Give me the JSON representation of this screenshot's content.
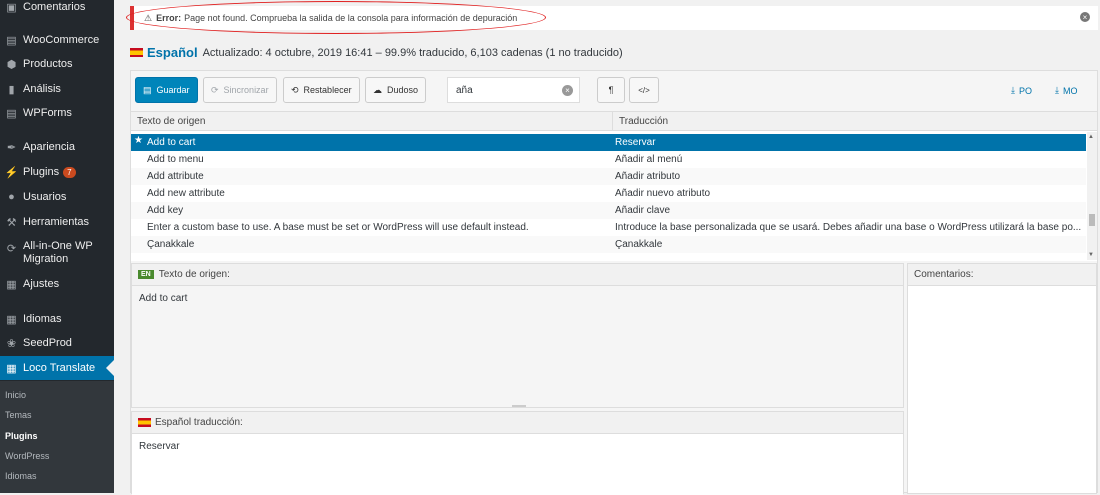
{
  "sidebar": {
    "items": [
      {
        "label": "Comentarios",
        "icon": "comment-icon"
      },
      {
        "label": "WooCommerce",
        "icon": "woo-icon"
      },
      {
        "label": "Productos",
        "icon": "box-icon"
      },
      {
        "label": "Análisis",
        "icon": "bar-chart-icon"
      },
      {
        "label": "WPForms",
        "icon": "forms-icon"
      },
      {
        "label": "Apariencia",
        "icon": "brush-icon"
      },
      {
        "label": "Plugins",
        "icon": "plug-icon",
        "badge": "7"
      },
      {
        "label": "Usuarios",
        "icon": "user-icon"
      },
      {
        "label": "Herramientas",
        "icon": "wrench-icon"
      },
      {
        "label": "All-in-One WP",
        "label2": "Migration",
        "icon": "migration-icon"
      },
      {
        "label": "Ajustes",
        "icon": "settings-icon"
      },
      {
        "label": "Idiomas",
        "icon": "language-icon"
      },
      {
        "label": "SeedProd",
        "icon": "seed-icon"
      },
      {
        "label": "Loco Translate",
        "icon": "translate-icon"
      }
    ],
    "submenu": [
      "Inicio",
      "Temas",
      "Plugins",
      "WordPress",
      "Idiomas"
    ]
  },
  "notice": {
    "prefix": "Error:",
    "message": "Page not found. Comprueba la salida de la consola para información de depuración"
  },
  "locale": {
    "name": "Español",
    "status": "Actualizado: 4 octubre, 2019 16:41 – 99.9% traducido, 6,103 cadenas (1 no traducido)"
  },
  "toolbar": {
    "save": "Guardar",
    "sync": "Sincronizar",
    "revert": "Restablecer",
    "fuzzy": "Dudoso",
    "search_value": "aña",
    "invisibles": "¶",
    "code": "</>",
    "po": "PO",
    "mo": "MO"
  },
  "grid": {
    "col_source": "Texto de origen",
    "col_translation": "Traducción",
    "rows": [
      {
        "source": "Add to cart",
        "translation": "Reservar"
      },
      {
        "source": "Add to menu",
        "translation": "Añadir al menú"
      },
      {
        "source": "Add attribute",
        "translation": "Añadir atributo"
      },
      {
        "source": "Add new attribute",
        "translation": "Añadir nuevo atributo"
      },
      {
        "source": "Add key",
        "translation": "Añadir clave"
      },
      {
        "source": "Enter a custom base to use. A base must be set or WordPress will use default instead.",
        "translation": "Introduce la base personalizada que se usará. Debes añadir una base o WordPress utilizará la base po..."
      },
      {
        "source": "Çanakkale",
        "translation": "Çanakkale"
      }
    ]
  },
  "source_panel": {
    "tag": "EN",
    "title": "Texto de origen:",
    "text": "Add to cart"
  },
  "translation_panel": {
    "title": "Español traducción:",
    "text": "Reservar"
  },
  "comments_panel": {
    "title": "Comentarios:"
  }
}
